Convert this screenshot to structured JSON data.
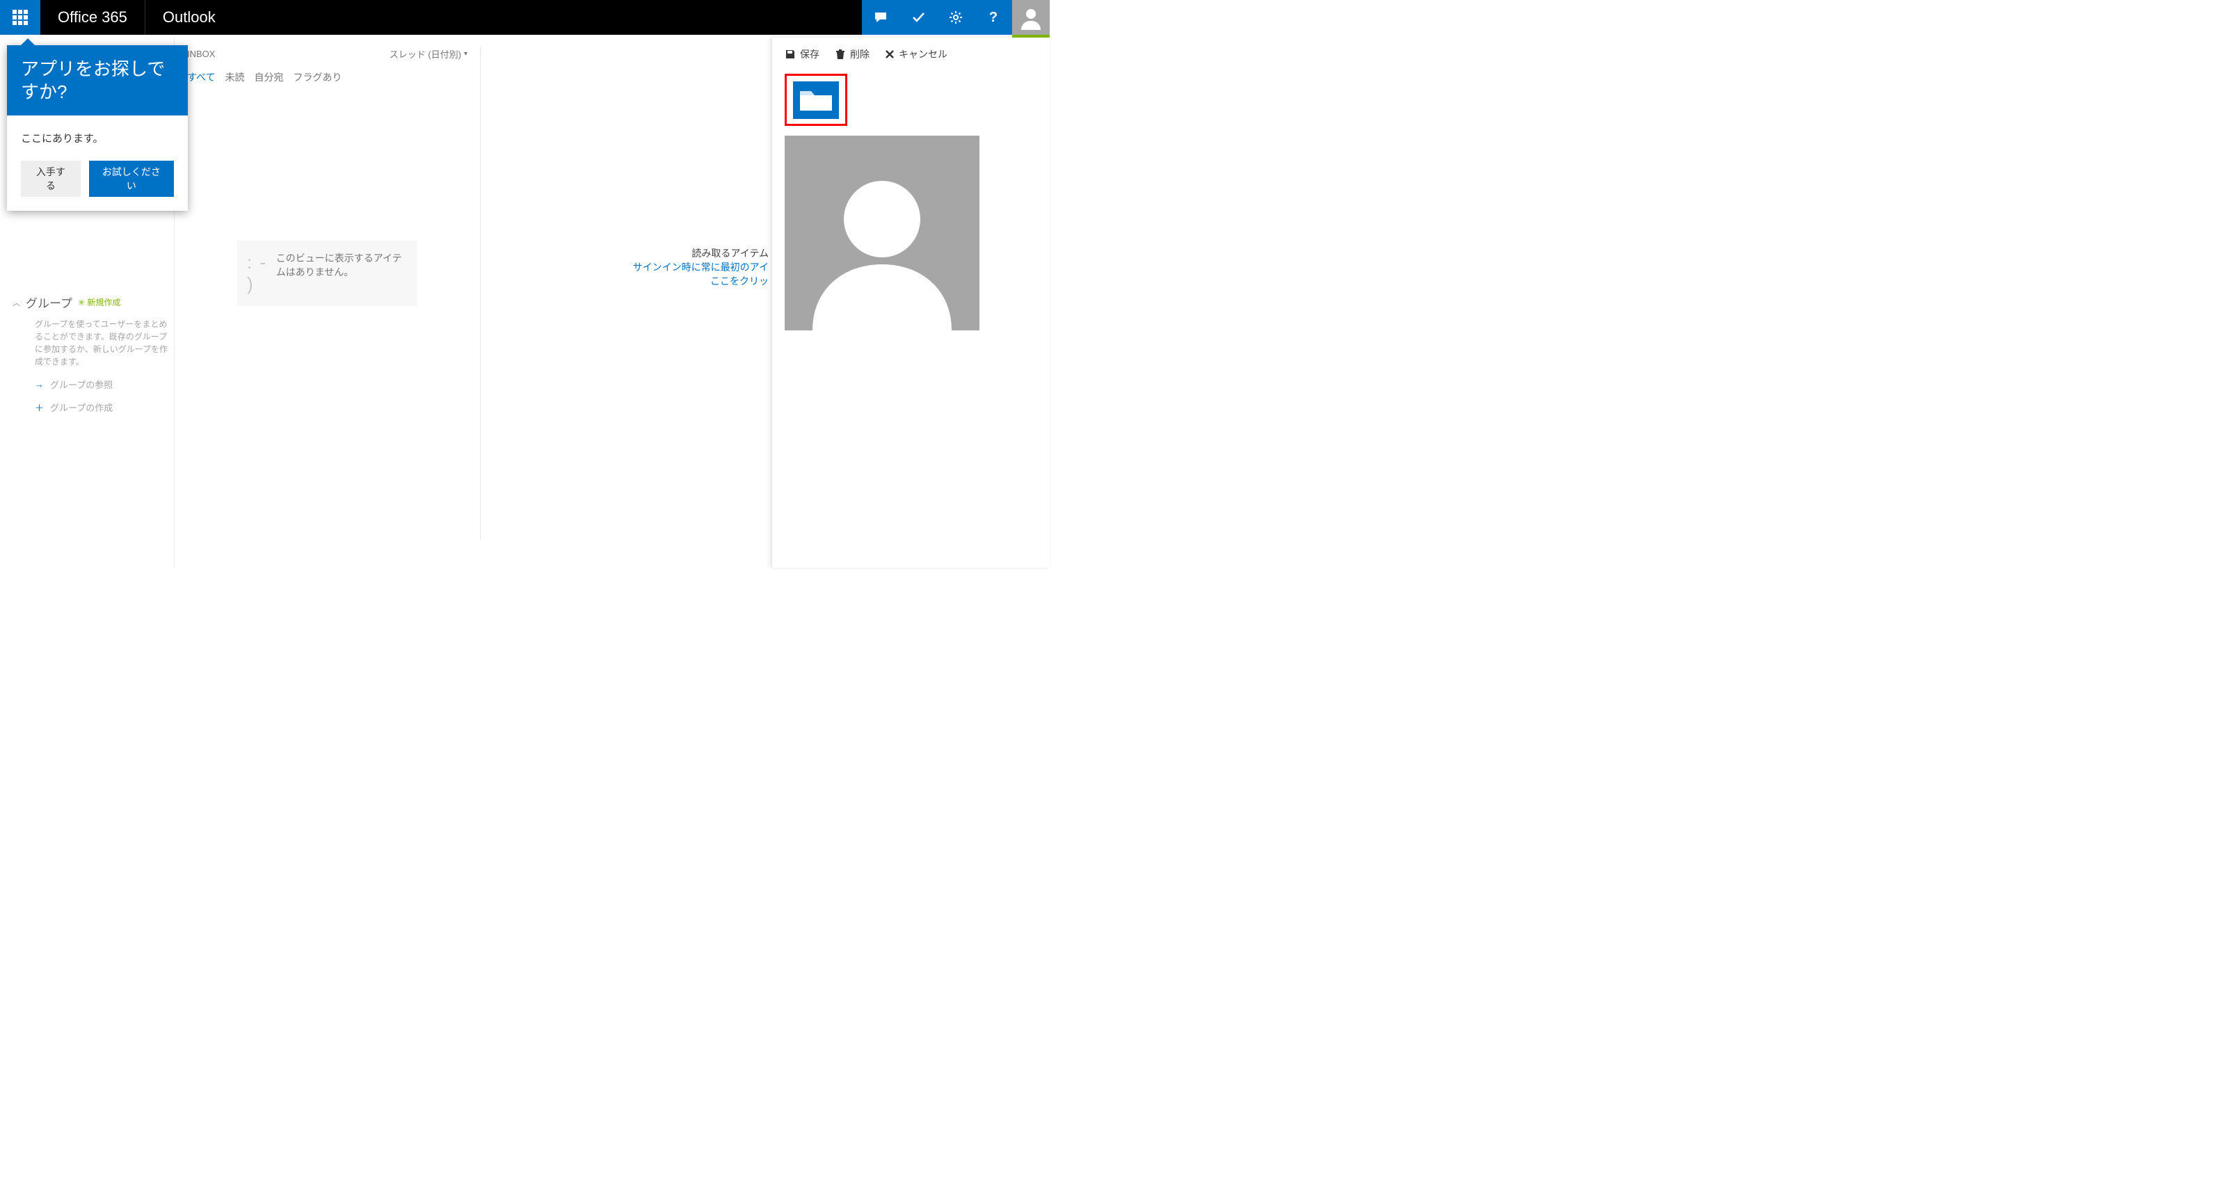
{
  "header": {
    "brand": "Office 365",
    "app": "Outlook"
  },
  "callout": {
    "title": "アプリをお探しですか?",
    "body": "ここにあります。",
    "secondary": "入手する",
    "primary": "お試しください"
  },
  "sidebar": {
    "groups_title": "グループ",
    "new_badge": "✳ 新規作成",
    "groups_desc": "グループを使ってユーザーをまとめることができます。既存のグループに参加するか、新しいグループを作成できます。",
    "browse": "グループの参照",
    "create": "グループの作成"
  },
  "mid": {
    "inbox": "INBOX",
    "sort": "スレッド (日付別)",
    "filters": {
      "all": "すべて",
      "unread": "未読",
      "tome": "自分宛",
      "flagged": "フラグあり"
    },
    "smiley": ": - )",
    "empty": "このビューに表示するアイテムはありません。"
  },
  "read": {
    "line1": "読み取るアイテム",
    "line2": "サインイン時に常に最初のアイ",
    "line3": "ここをクリッ"
  },
  "rightpanel": {
    "save": "保存",
    "delete": "削除",
    "cancel": "キャンセル"
  }
}
